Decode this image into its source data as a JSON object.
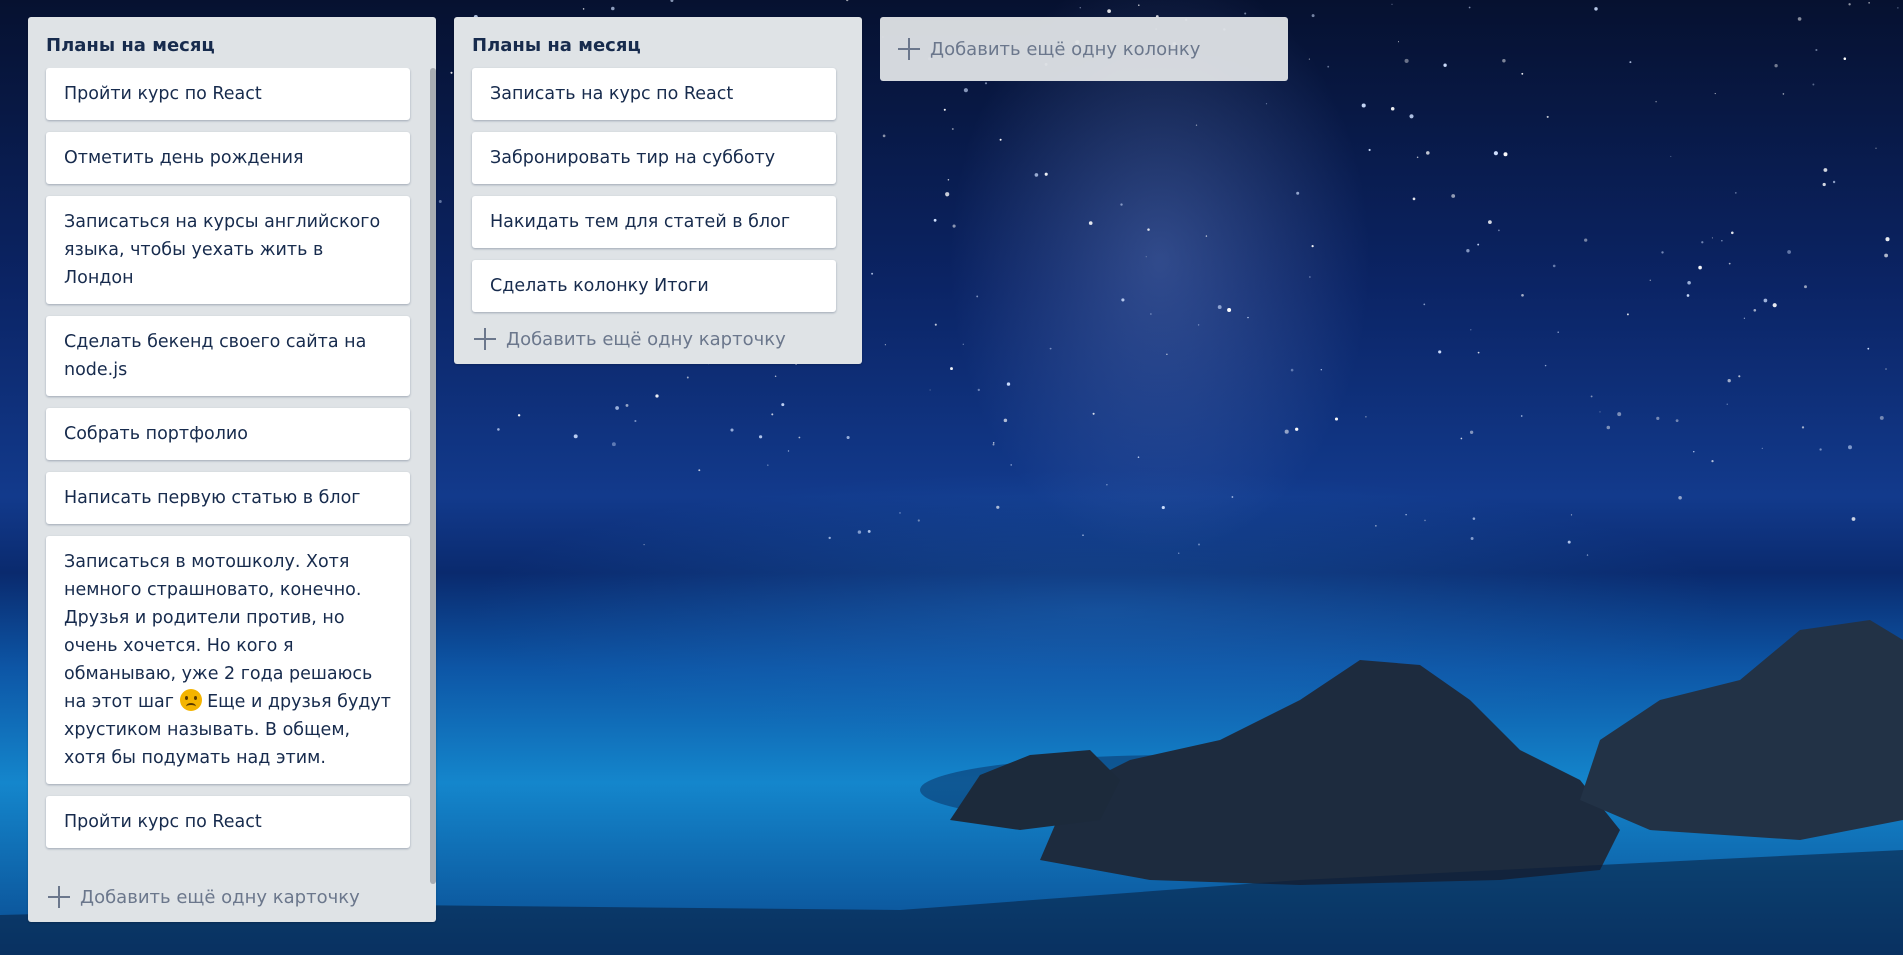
{
  "columns": [
    {
      "title": "Планы на месяц",
      "cards": [
        "Пройти курс по React",
        "Отметить день рождения",
        "Записаться на курсы английского языка, чтобы уехать жить в Лондон",
        "Сделать бекенд своего сайта на node.js",
        "Собрать портфолио",
        "Написать первую статью в блог",
        "Записаться в мотошколу. Хотя немного страшновато, конечно. Друзья и родители против, но очень хочется. Но кого я обманываю, уже 2 года решаюсь на этот шаг",
        "Еще и друзья будут хрустиком называть. В общем, хотя бы подумать над этим.",
        "Пройти курс по React"
      ],
      "add_card_label": "Добавить ещё одну карточку"
    },
    {
      "title": "Планы на месяц",
      "cards": [
        "Записать на курс по React",
        "Забронировать тир на субботу",
        "Накидать тем для статей в блог",
        "Сделать колонку Итоги"
      ],
      "add_card_label": "Добавить ещё одну карточку"
    }
  ],
  "add_column_label": "Добавить ещё одну колонку",
  "colors": {
    "column_bg": "#dfe3e6",
    "card_bg": "#ffffff",
    "text": "#172b4d",
    "muted": "#6b778c"
  },
  "icons": [
    "plus-icon",
    "sad-emoji-icon"
  ]
}
